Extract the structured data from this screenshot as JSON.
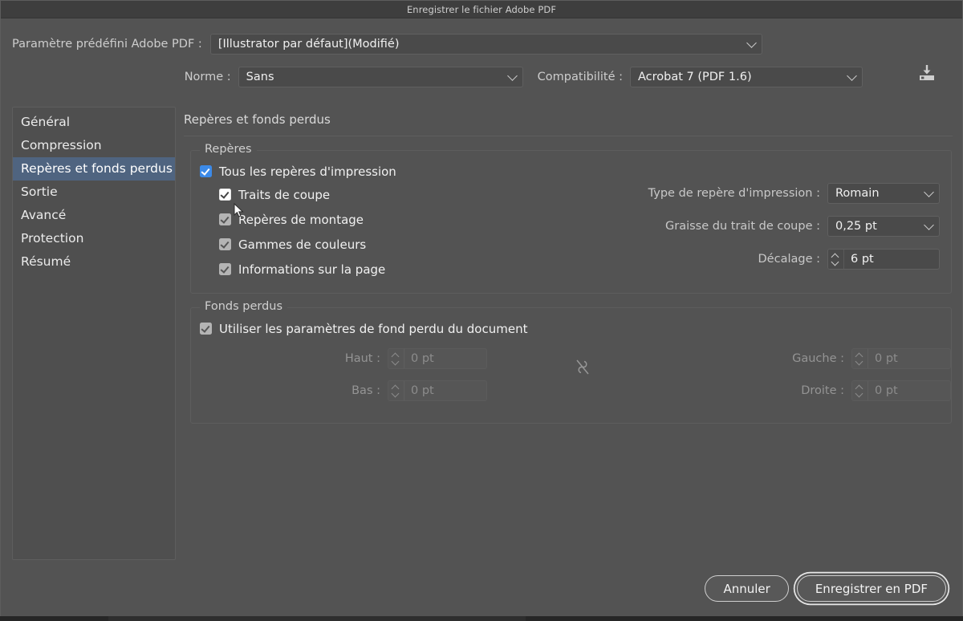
{
  "window": {
    "title": "Enregistrer le fichier Adobe PDF"
  },
  "header": {
    "preset_label": "Paramètre prédéfini Adobe PDF :",
    "preset_value": "[Illustrator par défaut](Modifié)",
    "norme_label": "Norme :",
    "norme_value": "Sans",
    "compat_label": "Compatibilité :",
    "compat_value": "Acrobat 7 (PDF 1.6)",
    "save_preset_icon": "save-preset-icon"
  },
  "sidebar": {
    "items": [
      {
        "label": "Général",
        "selected": false
      },
      {
        "label": "Compression",
        "selected": false
      },
      {
        "label": "Repères et fonds perdus",
        "selected": true
      },
      {
        "label": "Sortie",
        "selected": false
      },
      {
        "label": "Avancé",
        "selected": false
      },
      {
        "label": "Protection",
        "selected": false
      },
      {
        "label": "Résumé",
        "selected": false
      }
    ]
  },
  "content": {
    "title": "Repères et fonds perdus",
    "marks": {
      "legend": "Repères",
      "all_marks": {
        "label": "Tous les repères d'impression",
        "checked": true,
        "state": "blue"
      },
      "sub": [
        {
          "label": "Traits de coupe",
          "checked": true,
          "state": "white"
        },
        {
          "label": "Repères de montage",
          "checked": true,
          "state": "grey"
        },
        {
          "label": "Gammes de couleurs",
          "checked": true,
          "state": "grey"
        },
        {
          "label": "Informations sur la page",
          "checked": true,
          "state": "grey"
        }
      ],
      "mark_type_label": "Type de repère d'impression :",
      "mark_type_value": "Romain",
      "weight_label": "Graisse du trait de coupe :",
      "weight_value": "0,25 pt",
      "offset_label": "Décalage :",
      "offset_value": "6 pt"
    },
    "bleed": {
      "legend": "Fonds perdus",
      "use_doc": {
        "label": "Utiliser les paramètres de fond perdu du document",
        "checked": true,
        "state": "grey"
      },
      "top_label": "Haut :",
      "top_value": "0 pt",
      "bottom_label": "Bas :",
      "bottom_value": "0 pt",
      "left_label": "Gauche :",
      "left_value": "0 pt",
      "right_label": "Droite :",
      "right_value": "0 pt",
      "link_icon": "broken-link-icon"
    }
  },
  "footer": {
    "cancel_label": "Annuler",
    "save_label": "Enregistrer en PDF"
  },
  "colors": {
    "dialog_bg": "#535353",
    "titlebar_bg": "#3e3e3e",
    "accent_checkbox": "#3c8ae8",
    "selection": "#4f6480",
    "field_bg": "#4a4a4a",
    "text": "#f1f1f1"
  }
}
